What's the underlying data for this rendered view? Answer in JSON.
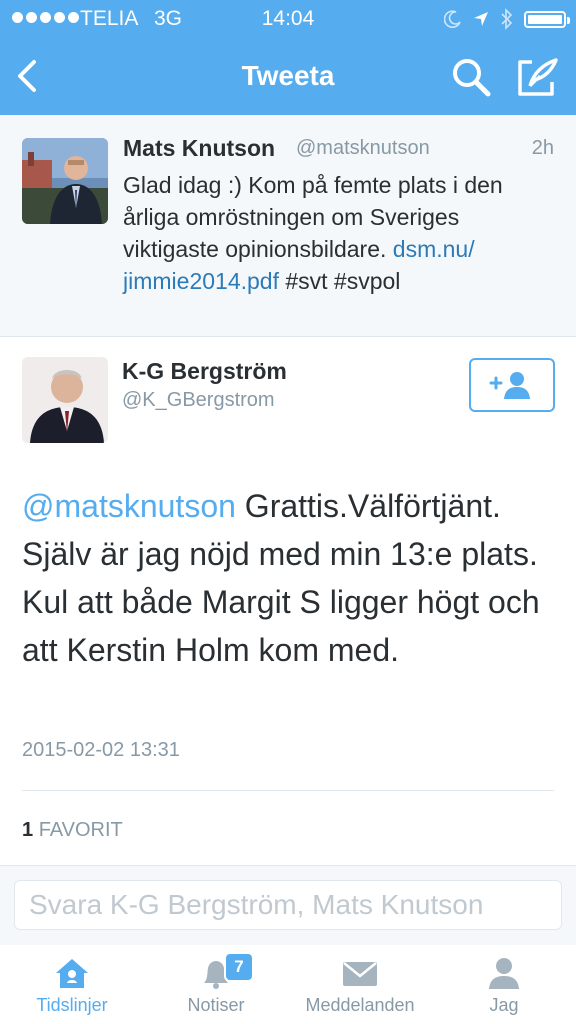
{
  "status_bar": {
    "carrier": "TELIA",
    "network": "3G",
    "time": "14:04",
    "battery_level": 0.95
  },
  "nav": {
    "title": "Tweeta",
    "back_icon": "chevron-left-icon",
    "search_icon": "search-icon",
    "compose_icon": "compose-icon"
  },
  "parent_tweet": {
    "name": "Mats Knutson",
    "handle": "@matsknutson",
    "time": "2h",
    "text": "Glad idag :) Kom på femte plats i den årliga omröstningen om Sveriges viktigaste opinionsbildare. ",
    "link_part1": "dsm.nu/",
    "link_part2": "jimmie2014.pdf",
    "hashtags": " #svt #svpol"
  },
  "tweet": {
    "name": "K-G Bergström",
    "handle": "@K_GBergstrom",
    "mention": "@matsknutson",
    "text": " Grattis.Välförtjänt. Själv är jag nöjd med min 13:e plats. Kul att både Margit S ligger högt och att Kerstin Holm kom med.",
    "date": "2015-02-02 13:31",
    "favorites_count": "1",
    "favorites_label": "FAVORIT",
    "follow_icon": "add-user-icon"
  },
  "reply": {
    "placeholder": "Svara K-G Bergström, Mats Knutson"
  },
  "tabbar": {
    "items": [
      {
        "label": "Tidslinjer",
        "icon": "home-icon",
        "active": true
      },
      {
        "label": "Notiser",
        "icon": "bell-icon",
        "badge": "7"
      },
      {
        "label": "Meddelanden",
        "icon": "envelope-icon"
      },
      {
        "label": "Jag",
        "icon": "person-icon"
      }
    ]
  },
  "colors": {
    "brand": "#55acee",
    "link": "#2b7bb9",
    "muted": "#8899a6",
    "text": "#292f33"
  }
}
